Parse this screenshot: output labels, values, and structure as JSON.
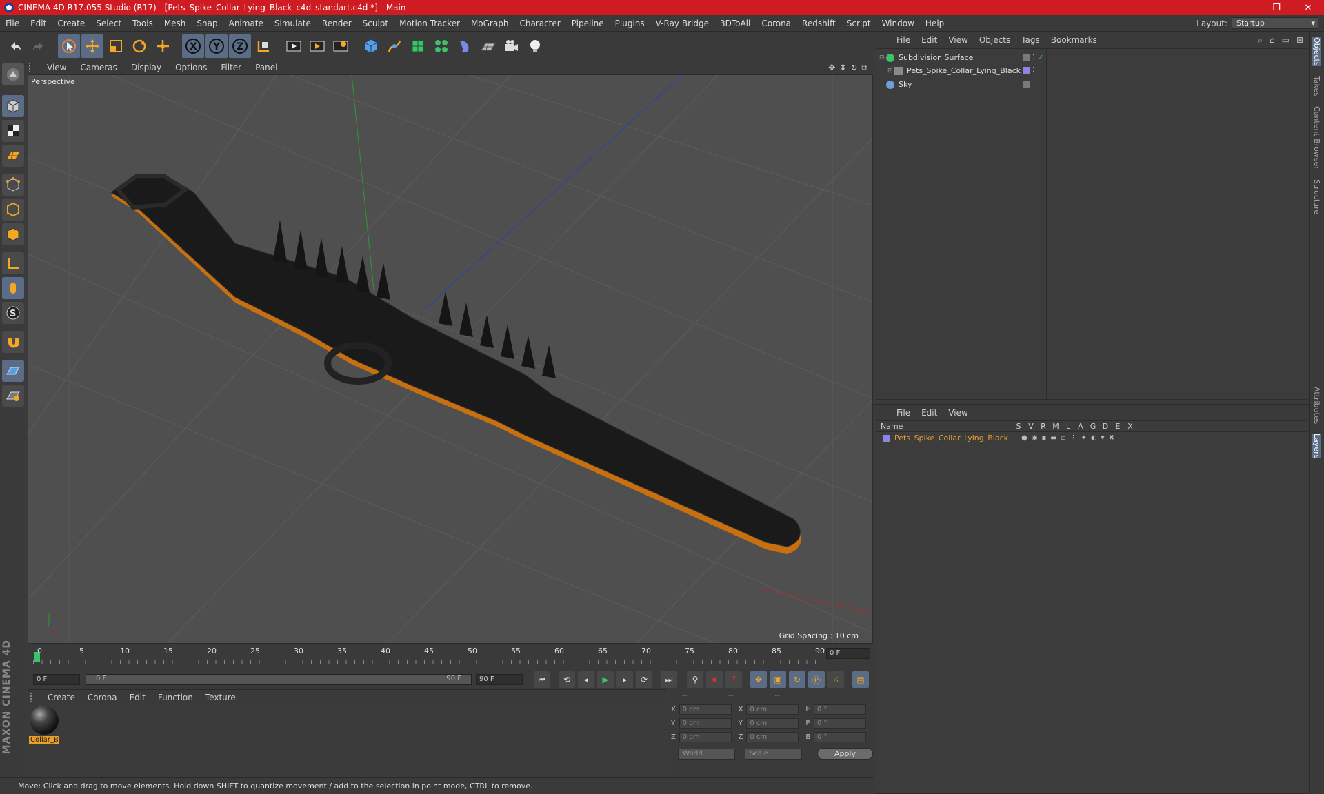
{
  "app": {
    "title": "CINEMA 4D R17.055 Studio (R17) - [Pets_Spike_Collar_Lying_Black_c4d_standart.c4d *] - Main",
    "window_buttons": [
      "–",
      "❐",
      "✕"
    ]
  },
  "menubar": {
    "items": [
      "File",
      "Edit",
      "Create",
      "Select",
      "Tools",
      "Mesh",
      "Snap",
      "Animate",
      "Simulate",
      "Render",
      "Sculpt",
      "Motion Tracker",
      "MoGraph",
      "Character",
      "Pipeline",
      "Plugins",
      "V-Ray Bridge",
      "3DToAll",
      "Corona",
      "Redshift",
      "Script",
      "Window",
      "Help"
    ],
    "layout_label": "Layout:",
    "layout_value": "Startup"
  },
  "toolbar": {
    "icons": [
      "undo-icon",
      "redo-icon",
      "select-icon",
      "move-icon",
      "scale-icon",
      "rotate-icon",
      "multi-tool-icon",
      "x-axis-icon",
      "y-axis-icon",
      "z-axis-icon",
      "coordinate-system-icon",
      "render-view-icon",
      "render-picture-viewer-icon",
      "edit-render-settings-icon",
      "cube-icon",
      "pen-icon",
      "subdivision-icon",
      "cloner-icon",
      "deformer-icon",
      "floor-icon",
      "camera-icon",
      "light-icon"
    ],
    "axis_labels": [
      "X",
      "Y",
      "Z"
    ]
  },
  "lefttools": {
    "icons": [
      "make-editable-icon",
      "model-mode-icon",
      "texture-mode-icon",
      "workplane-icon",
      "points-mode-icon",
      "edges-mode-icon",
      "polygons-mode-icon",
      "axis-mode-icon",
      "tweak-mode-icon",
      "solo-icon",
      "magnet-icon",
      "snap-icon",
      "workplane-lock-icon"
    ],
    "brand": "MAXON CINEMA 4D"
  },
  "viewport": {
    "menu": [
      "View",
      "Cameras",
      "Display",
      "Options",
      "Filter",
      "Panel"
    ],
    "label": "Perspective",
    "grid_spacing": "Grid Spacing : 10 cm"
  },
  "timeline": {
    "labels": [
      "0",
      "5",
      "10",
      "15",
      "20",
      "25",
      "30",
      "35",
      "40",
      "45",
      "50",
      "55",
      "60",
      "65",
      "70",
      "75",
      "80",
      "85",
      "90"
    ],
    "current_frame": "0 F"
  },
  "playback": {
    "start": "0 F",
    "range_start": "0 F",
    "range_end": "90 F",
    "end": "90 F"
  },
  "material_manager": {
    "menu": [
      "Create",
      "Corona",
      "Edit",
      "Function",
      "Texture"
    ],
    "materials": [
      {
        "name": "Collar_B"
      }
    ]
  },
  "coordinates": {
    "header": [
      "--",
      "--",
      "--"
    ],
    "rows": [
      {
        "a1": "X",
        "v1": "0 cm",
        "a2": "X",
        "v2": "0 cm",
        "a3": "H",
        "v3": "0 °"
      },
      {
        "a1": "Y",
        "v1": "0 cm",
        "a2": "Y",
        "v2": "0 cm",
        "a3": "P",
        "v3": "0 °"
      },
      {
        "a1": "Z",
        "v1": "0 cm",
        "a2": "Z",
        "v2": "0 cm",
        "a3": "B",
        "v3": "0 °"
      }
    ],
    "mode1": "World",
    "mode2": "Scale",
    "apply": "Apply"
  },
  "status": "Move: Click and drag to move elements. Hold down SHIFT to quantize movement / add to the selection in point mode, CTRL to remove.",
  "object_manager": {
    "menu": [
      "File",
      "Edit",
      "View",
      "Objects",
      "Tags",
      "Bookmarks"
    ],
    "objects": [
      {
        "name": "Subdivision Surface",
        "color": "#3cc36a"
      },
      {
        "name": "Pets_Spike_Collar_Lying_Black",
        "color": "#8a8a8a"
      },
      {
        "name": "Sky",
        "color": "#6aa0d8"
      }
    ]
  },
  "layer_manager": {
    "menu": [
      "File",
      "Edit",
      "View"
    ],
    "header_name": "Name",
    "header_cols": [
      "S",
      "V",
      "R",
      "M",
      "L",
      "A",
      "G",
      "D",
      "E",
      "X"
    ],
    "layers": [
      {
        "name": "Pets_Spike_Collar_Lying_Black",
        "color": "#8c86e0"
      }
    ]
  },
  "right_tabs": [
    "Objects",
    "Takes",
    "Content Browser",
    "Structure",
    "Attributes",
    "Layers"
  ],
  "colors": {
    "accent": "#cf1c22",
    "highlight": "#e8a02b",
    "active": "#5a6c86"
  }
}
